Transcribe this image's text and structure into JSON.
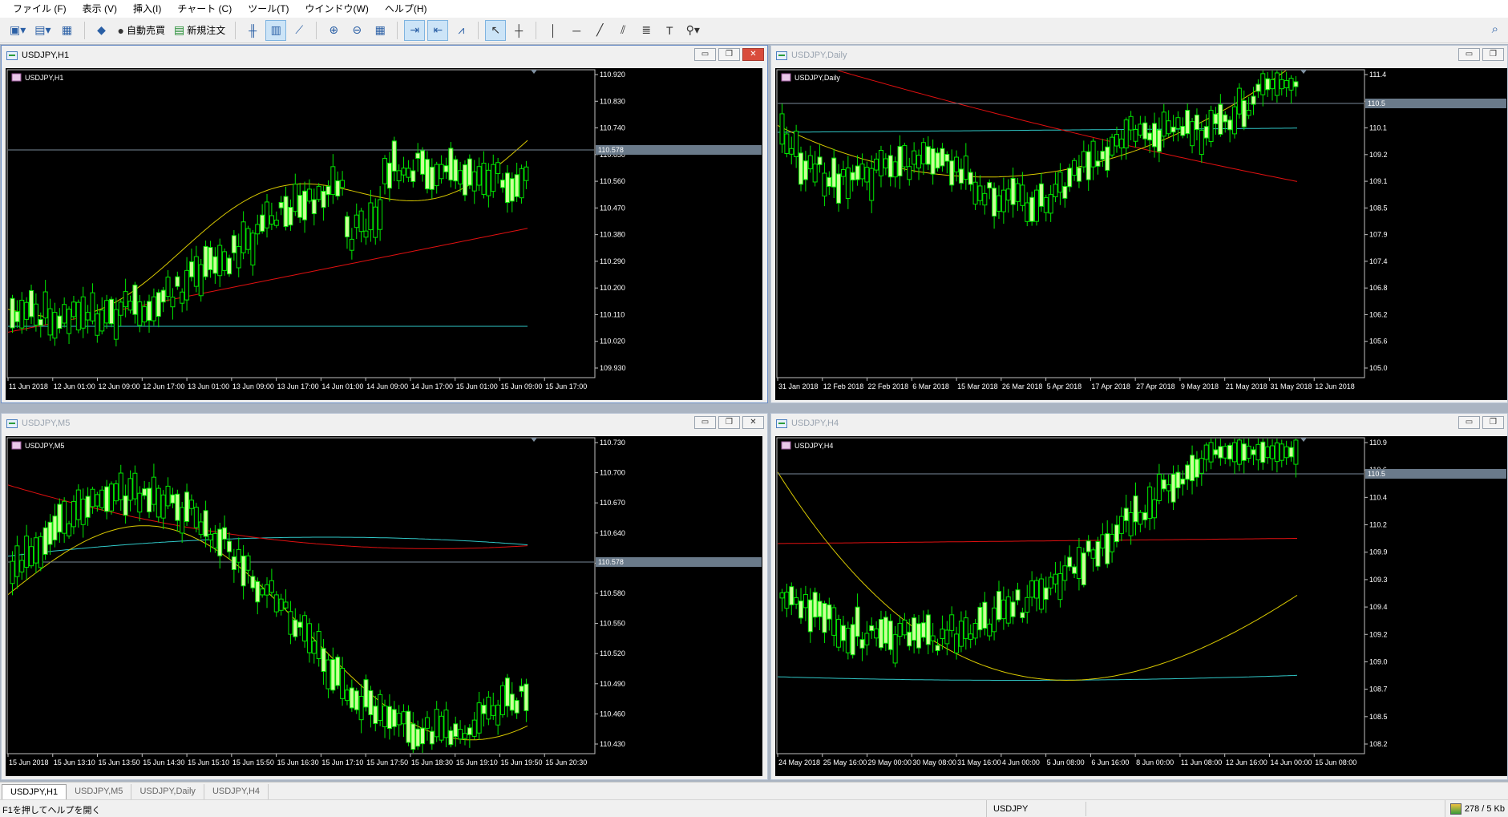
{
  "menu": [
    "ファイル (F)",
    "表示 (V)",
    "挿入(I)",
    "チャート (C)",
    "ツール(T)",
    "ウインドウ(W)",
    "ヘルプ(H)"
  ],
  "toolbar": {
    "auto_trading_label": "自動売買",
    "new_order_label": "新規注文"
  },
  "colors": {
    "chart_bg": "#000000",
    "candle_up": "#00e600",
    "candle_down": "#ccff99",
    "ma_fast": "#d8c800",
    "ma_mid": "#e01010",
    "ma_slow": "#30c8c8",
    "axis_text": "#ffffff",
    "bid_line": "#7a8a9a"
  },
  "charts": [
    {
      "window_title": "USDJPY,H1",
      "label": "USDJPY,H1",
      "active": true,
      "bid_label": "110.578",
      "y_labels": [
        "110.920",
        "110.830",
        "110.740",
        "110.650",
        "110.560",
        "110.470",
        "110.380",
        "110.290",
        "110.200",
        "110.110",
        "110.020",
        "109.930"
      ],
      "x_labels": [
        "11 Jun 2018",
        "12 Jun 01:00",
        "12 Jun 09:00",
        "12 Jun 17:00",
        "13 Jun 01:00",
        "13 Jun 09:00",
        "13 Jun 17:00",
        "14 Jun 01:00",
        "14 Jun 09:00",
        "14 Jun 17:00",
        "15 Jun 01:00",
        "15 Jun 09:00",
        "15 Jun 17:00"
      ]
    },
    {
      "window_title": "USDJPY,Daily",
      "label": "USDJPY,Daily",
      "active": false,
      "bid_label": "110.5",
      "y_labels": [
        "111.4",
        "110.5",
        "110.1",
        "109.2",
        "109.1",
        "108.5",
        "107.9",
        "107.4",
        "106.8",
        "106.2",
        "105.6",
        "105.0"
      ],
      "x_labels": [
        "31 Jan 2018",
        "12 Feb 2018",
        "22 Feb 2018",
        "6 Mar 2018",
        "15 Mar 2018",
        "26 Mar 2018",
        "5 Apr 2018",
        "17 Apr 2018",
        "27 Apr 2018",
        "9 May 2018",
        "21 May 2018",
        "31 May 2018",
        "12 Jun 2018"
      ]
    },
    {
      "window_title": "USDJPY,M5",
      "label": "USDJPY,M5",
      "active": false,
      "bid_label": "110.578",
      "y_labels": [
        "110.730",
        "110.700",
        "110.670",
        "110.640",
        "110.610",
        "110.580",
        "110.550",
        "110.520",
        "110.490",
        "110.460",
        "110.430"
      ],
      "x_labels": [
        "15 Jun 2018",
        "15 Jun 13:10",
        "15 Jun 13:50",
        "15 Jun 14:30",
        "15 Jun 15:10",
        "15 Jun 15:50",
        "15 Jun 16:30",
        "15 Jun 17:10",
        "15 Jun 17:50",
        "15 Jun 18:30",
        "15 Jun 19:10",
        "15 Jun 19:50",
        "15 Jun 20:30"
      ]
    },
    {
      "window_title": "USDJPY,H4",
      "label": "USDJPY,H4",
      "active": false,
      "bid_label": "110.5",
      "y_labels": [
        "110.9",
        "110.6",
        "110.4",
        "110.2",
        "109.9",
        "109.3",
        "109.4",
        "109.2",
        "109.0",
        "108.7",
        "108.5",
        "108.2"
      ],
      "x_labels": [
        "24 May 2018",
        "25 May 16:00",
        "29 May 00:00",
        "30 May 08:00",
        "31 May 16:00",
        "4 Jun 00:00",
        "5 Jun 08:00",
        "6 Jun 16:00",
        "8 Jun 00:00",
        "11 Jun 08:00",
        "12 Jun 16:00",
        "14 Jun 00:00",
        "15 Jun 08:00"
      ]
    }
  ],
  "tabs": [
    "USDJPY,H1",
    "USDJPY,M5",
    "USDJPY,Daily",
    "USDJPY,H4"
  ],
  "status": {
    "help": "F1を押してヘルプを開く",
    "symbol": "USDJPY",
    "traffic": "278 / 5 Kb"
  }
}
